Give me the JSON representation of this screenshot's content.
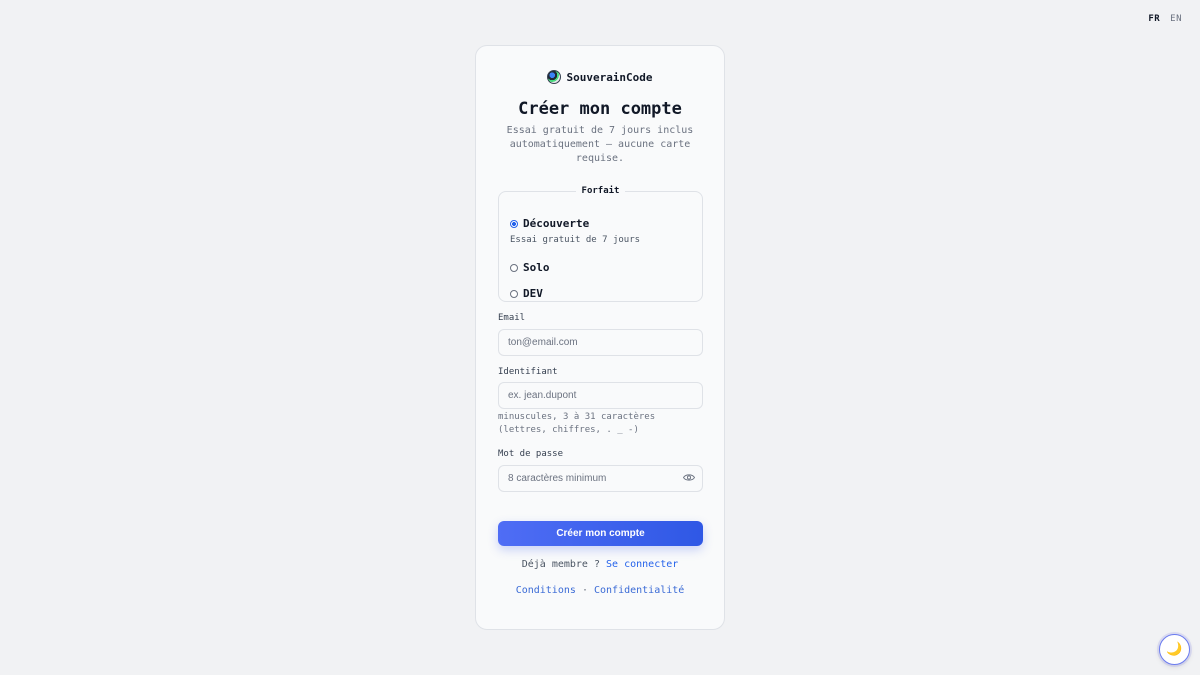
{
  "lang": {
    "fr": "FR",
    "en": "EN"
  },
  "brand": {
    "name": "SouverainCode",
    "icon": "globe-logo-icon"
  },
  "title": "Créer mon compte",
  "subtitle": "Essai gratuit de 7 jours inclus automatiquement — aucune carte requise.",
  "plans": {
    "legend": "Forfait",
    "options": [
      {
        "label": "Découverte",
        "selected": true,
        "description": "Essai gratuit de 7 jours"
      },
      {
        "label": "Solo",
        "selected": false
      },
      {
        "label": "DEV",
        "selected": false
      }
    ]
  },
  "fields": {
    "email": {
      "label": "Email",
      "placeholder": "ton@email.com",
      "value": ""
    },
    "username": {
      "label": "Identifiant",
      "placeholder": "ex. jean.dupont",
      "value": "",
      "hint": "minuscules, 3 à 31 caractères (lettres, chiffres, . _ -)"
    },
    "password": {
      "label": "Mot de passe",
      "placeholder": "8 caractères minimum",
      "value": "",
      "toggle_icon": "eye-icon"
    }
  },
  "submit_label": "Créer mon compte",
  "login": {
    "prompt": "Déjà membre ?",
    "link": "Se connecter"
  },
  "footer": {
    "terms": "Conditions",
    "separator": "·",
    "privacy": "Confidentialité"
  },
  "theme_toggle": {
    "icon": "moon-icon",
    "glyph": "🌙"
  },
  "colors": {
    "accent": "#2f58e5",
    "link": "#2563eb",
    "background": "#f1f2f4"
  }
}
